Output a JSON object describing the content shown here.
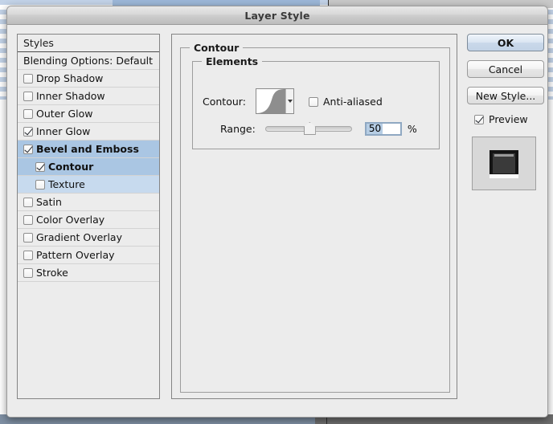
{
  "window": {
    "title": "Layer Style"
  },
  "sidebar": {
    "header": "Styles",
    "preset": "Blending Options: Default",
    "items": [
      {
        "label": "Drop Shadow",
        "checked": false,
        "sub": false,
        "selected": "none"
      },
      {
        "label": "Inner Shadow",
        "checked": false,
        "sub": false,
        "selected": "none"
      },
      {
        "label": "Outer Glow",
        "checked": false,
        "sub": false,
        "selected": "none"
      },
      {
        "label": "Inner Glow",
        "checked": true,
        "sub": false,
        "selected": "none"
      },
      {
        "label": "Bevel and Emboss",
        "checked": true,
        "sub": false,
        "selected": "strong"
      },
      {
        "label": "Contour",
        "checked": true,
        "sub": true,
        "selected": "strong"
      },
      {
        "label": "Texture",
        "checked": false,
        "sub": true,
        "selected": "light"
      },
      {
        "label": "Satin",
        "checked": false,
        "sub": false,
        "selected": "none"
      },
      {
        "label": "Color Overlay",
        "checked": false,
        "sub": false,
        "selected": "none"
      },
      {
        "label": "Gradient Overlay",
        "checked": false,
        "sub": false,
        "selected": "none"
      },
      {
        "label": "Pattern Overlay",
        "checked": false,
        "sub": false,
        "selected": "none"
      },
      {
        "label": "Stroke",
        "checked": false,
        "sub": false,
        "selected": "none"
      }
    ]
  },
  "main": {
    "group_title": "Contour",
    "elements_title": "Elements",
    "contour_label": "Contour:",
    "contour_swatch_icon": "contour-curve-swatch",
    "contour_dropdown_icon": "chevron-down-icon",
    "antialiased_label": "Anti-aliased",
    "antialiased_checked": false,
    "range_label": "Range:",
    "range_value": "50",
    "range_unit": "%",
    "range_slider_percent": 50
  },
  "buttons": {
    "ok": "OK",
    "cancel": "Cancel",
    "new_style": "New Style...",
    "preview_label": "Preview",
    "preview_checked": true,
    "preview_thumb_icon": "layer-preview-thumbnail"
  },
  "colors": {
    "selection_blue": "#aac6e3",
    "selection_blue_light": "#c7daee",
    "dialog_background": "#ececec",
    "text": "#111111",
    "field_highlight": "#b6cde4",
    "desktop_stripe": "#c3d3e8"
  }
}
